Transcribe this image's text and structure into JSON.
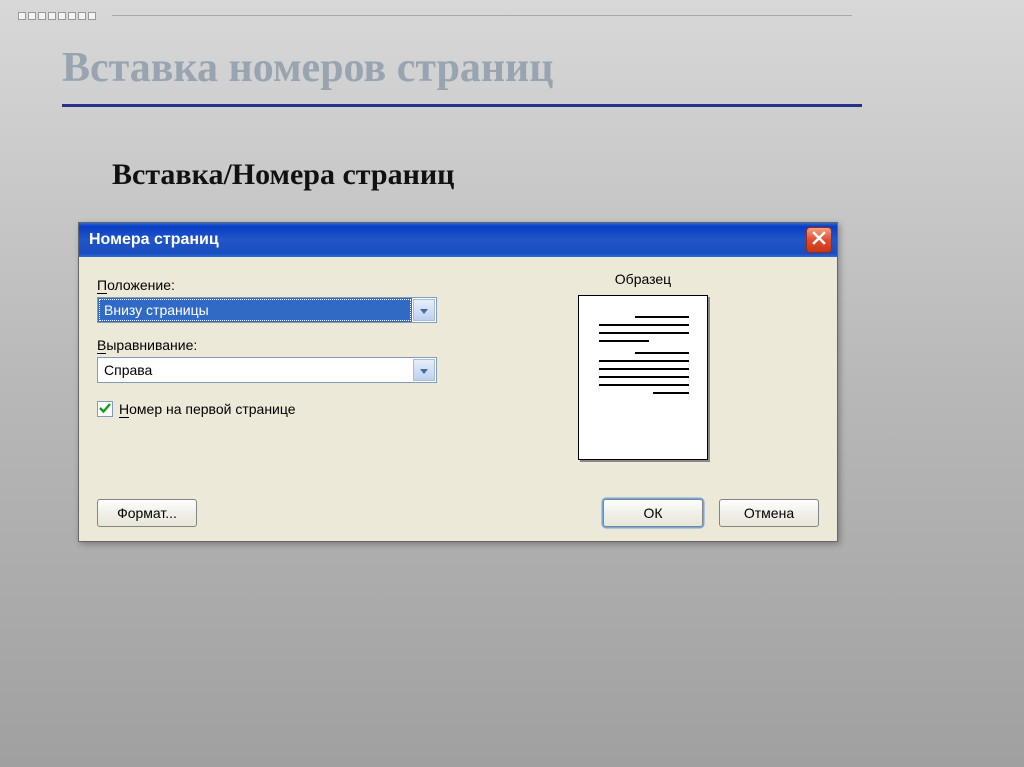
{
  "slide": {
    "heading": "Вставка номеров страниц",
    "subheading": "Вставка/Номера страниц"
  },
  "dialog": {
    "title": "Номера страниц",
    "labels": {
      "position_prefix": "П",
      "position_suffix": "оложение:",
      "alignment_prefix": "В",
      "alignment_suffix": "ыравнивание:",
      "firstpage_prefix": "Н",
      "firstpage_suffix": "омер на первой странице",
      "sample": "Образец"
    },
    "values": {
      "position": "Внизу страницы",
      "alignment": "Справа"
    },
    "buttons": {
      "format": "Формат...",
      "ok": "ОК",
      "cancel": "Отмена"
    }
  }
}
